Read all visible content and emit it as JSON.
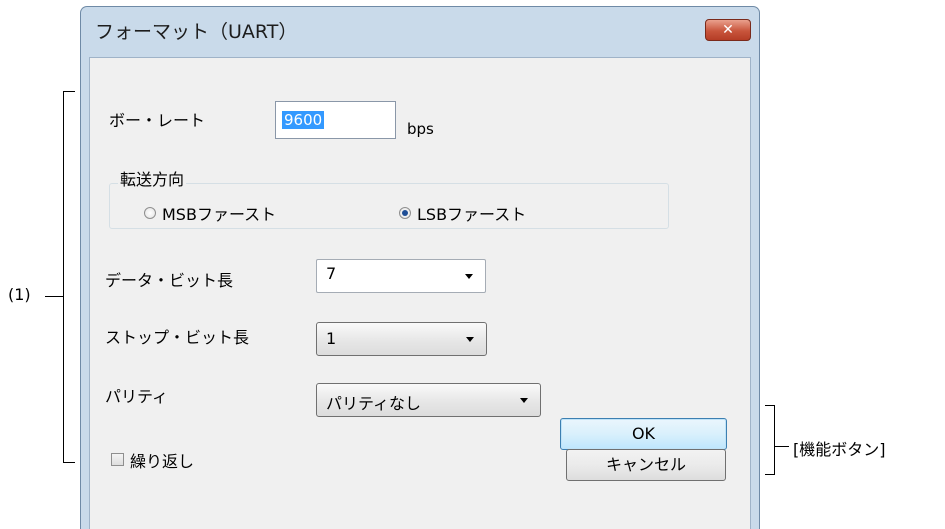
{
  "dialog": {
    "title": "フォーマット（UART）",
    "close_glyph": "✕"
  },
  "baud_rate": {
    "label": "ボー・レート",
    "value": "9600",
    "unit": "bps"
  },
  "transfer_direction": {
    "label": "転送方向",
    "options": [
      {
        "label": "MSBファースト",
        "checked": false
      },
      {
        "label": "LSBファースト",
        "checked": true
      }
    ]
  },
  "data_bit_length": {
    "label": "データ・ビット長",
    "selected": "7"
  },
  "stop_bit_length": {
    "label": "ストップ・ビット長",
    "selected": "1"
  },
  "parity": {
    "label": "パリティ",
    "selected": "パリティなし"
  },
  "repeat": {
    "label": "繰り返し",
    "checked": false
  },
  "buttons": {
    "ok_label": "OK",
    "cancel_label": "キャンセル"
  },
  "annotations": {
    "area1": "(1)",
    "function_buttons": "[機能ボタン]"
  }
}
